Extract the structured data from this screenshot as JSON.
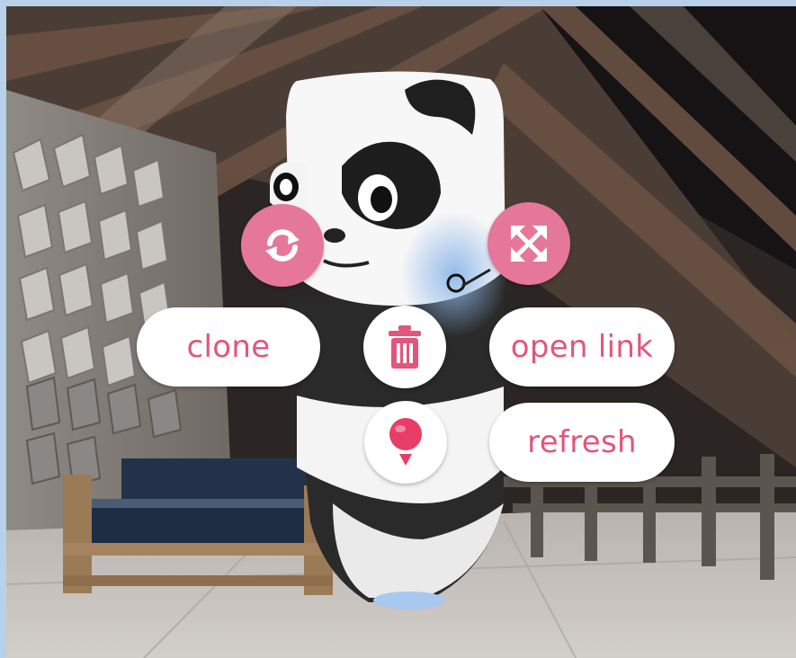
{
  "object_menu": {
    "clone_label": "clone",
    "open_link_label": "open link",
    "refresh_label": "refresh",
    "rotate_icon": "rotate-icon",
    "scale_icon": "scale-arrows-icon",
    "remove_icon": "trash-icon",
    "pin_icon": "pin-icon"
  },
  "colors": {
    "accent": "#e5779a",
    "label_text": "#e2557c",
    "button_bg": "#ffffff",
    "border": "#b9d0ea"
  }
}
